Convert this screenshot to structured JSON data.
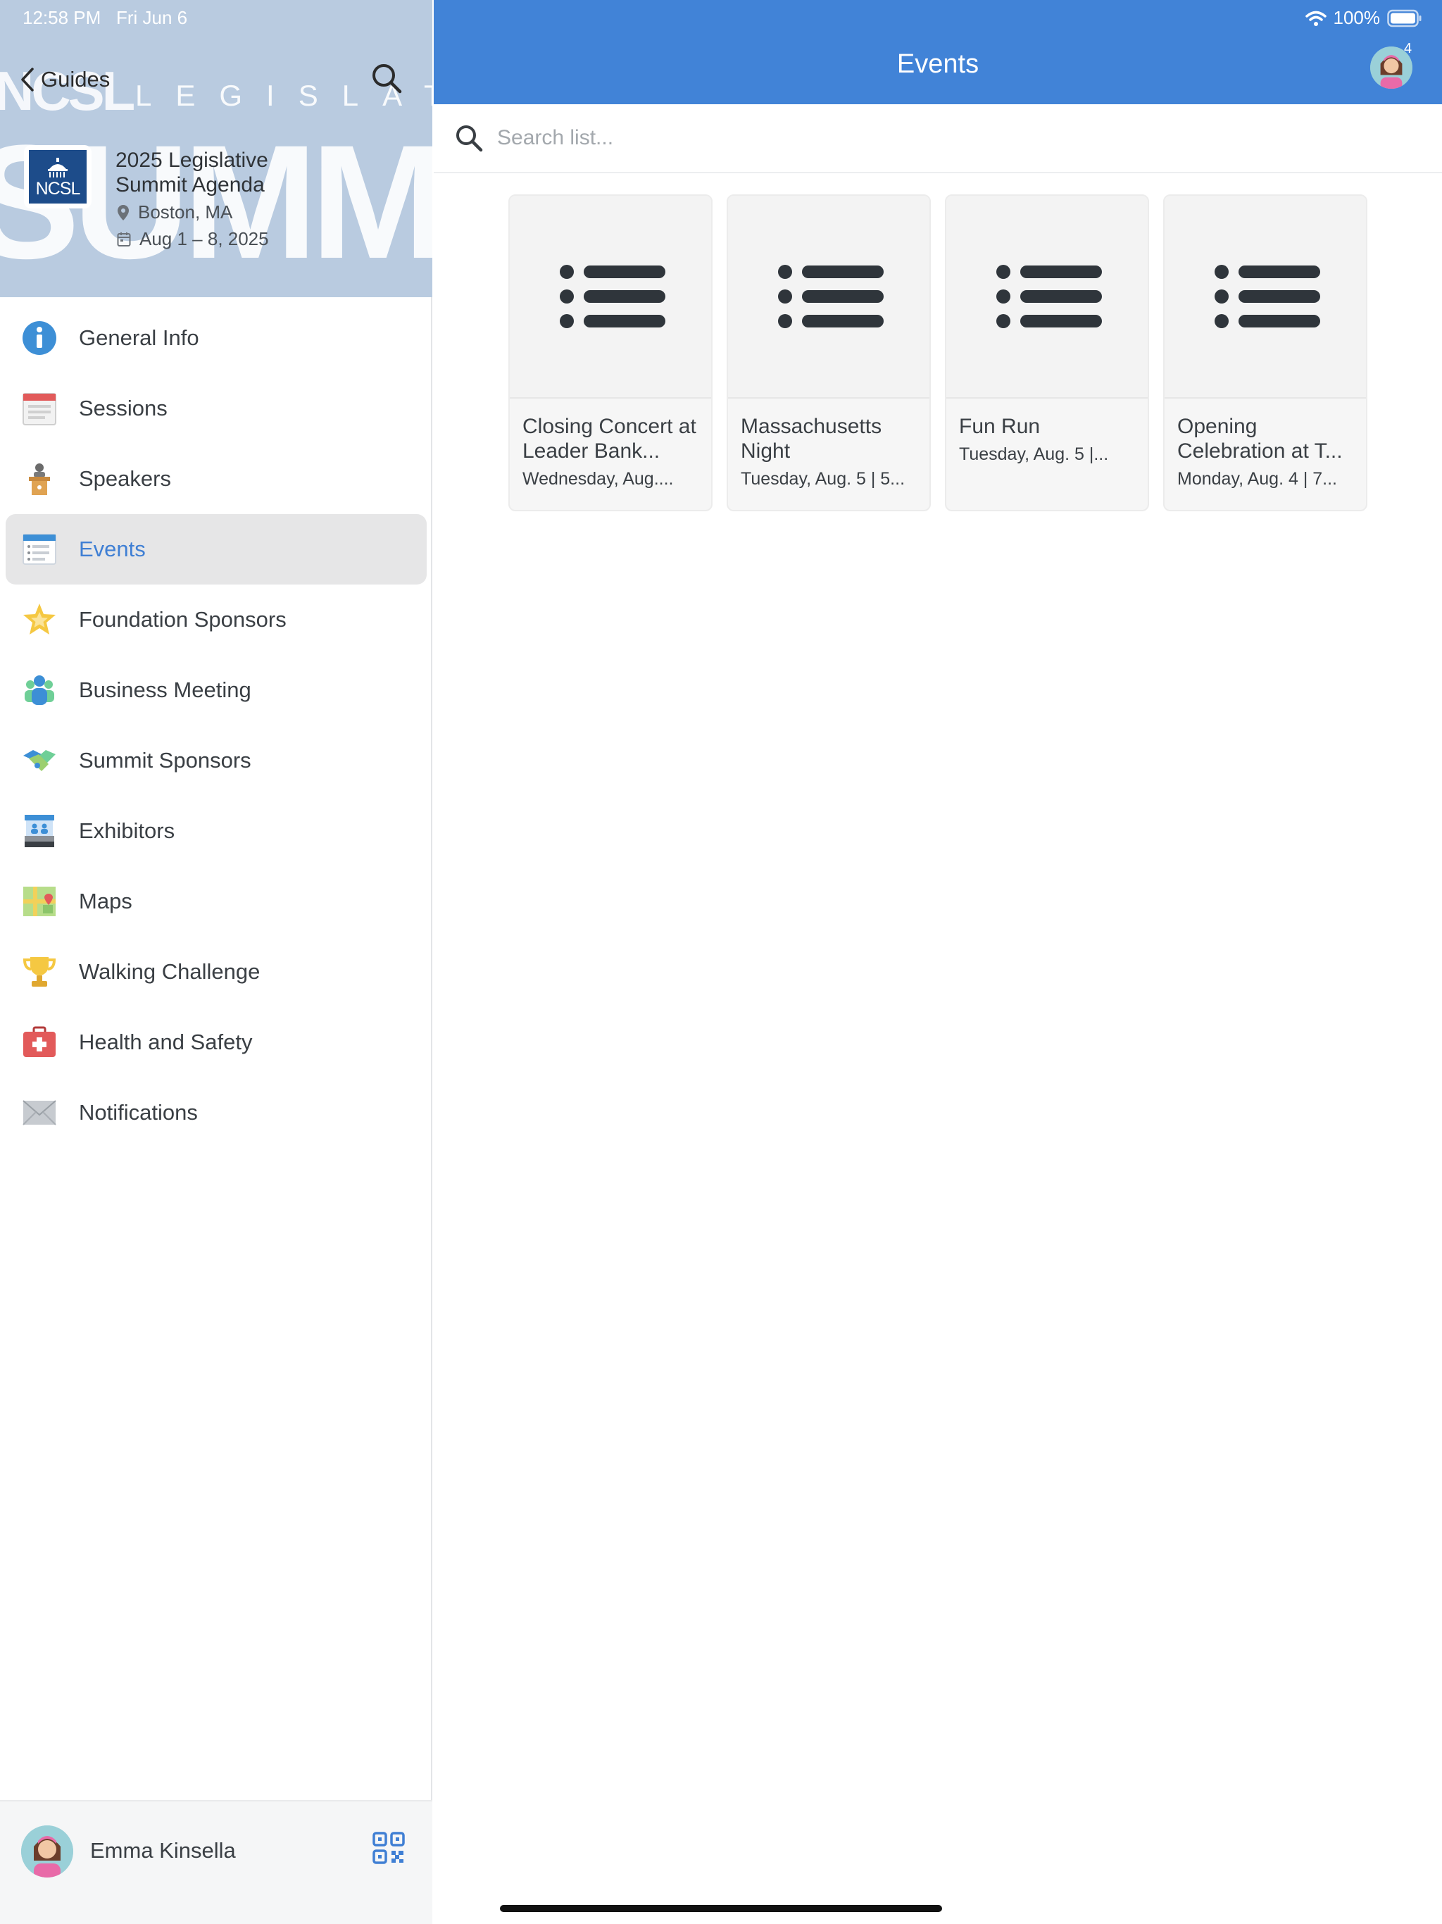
{
  "status_bar": {
    "time": "12:58 PM",
    "date": "Fri Jun 6",
    "battery": "100%"
  },
  "sidebar": {
    "back_label": "Guides",
    "header_bg_words": [
      "NCSL",
      "LEGISLATI",
      "SUMMIT"
    ],
    "guide": {
      "logo_text": "NCSL",
      "title": "2025 Legislative Summit Agenda",
      "location": "Boston, MA",
      "dates": "Aug 1 – 8, 2025"
    },
    "items": [
      {
        "label": "General Info",
        "icon": "info-icon"
      },
      {
        "label": "Sessions",
        "icon": "calendar-icon"
      },
      {
        "label": "Speakers",
        "icon": "podium-icon"
      },
      {
        "label": "Events",
        "icon": "event-list-icon",
        "active": true
      },
      {
        "label": "Foundation Sponsors",
        "icon": "star-icon"
      },
      {
        "label": "Business Meeting",
        "icon": "group-icon"
      },
      {
        "label": "Summit Sponsors",
        "icon": "handshake-icon"
      },
      {
        "label": "Exhibitors",
        "icon": "booth-icon"
      },
      {
        "label": "Maps",
        "icon": "map-icon"
      },
      {
        "label": "Walking Challenge",
        "icon": "trophy-icon"
      },
      {
        "label": "Health and Safety",
        "icon": "first-aid-icon"
      },
      {
        "label": "Notifications",
        "icon": "envelope-icon"
      }
    ],
    "user": {
      "name": "Emma Kinsella"
    }
  },
  "main": {
    "title": "Events",
    "avatar_badge": "4",
    "search": {
      "placeholder": "Search list..."
    },
    "cards": [
      {
        "title": "Closing Concert at Leader Bank...",
        "subtitle": "Wednesday, Aug...."
      },
      {
        "title": "Massachusetts Night",
        "subtitle": "Tuesday, Aug. 5 | 5..."
      },
      {
        "title": "Fun Run",
        "subtitle": "Tuesday, Aug. 5 |..."
      },
      {
        "title": "Opening Celebration at T...",
        "subtitle": "Monday, Aug. 4 | 7..."
      }
    ]
  },
  "colors": {
    "accent": "#4183d7",
    "active_item_bg": "#e6e6e7",
    "header_bg": "#b9cbe0"
  }
}
